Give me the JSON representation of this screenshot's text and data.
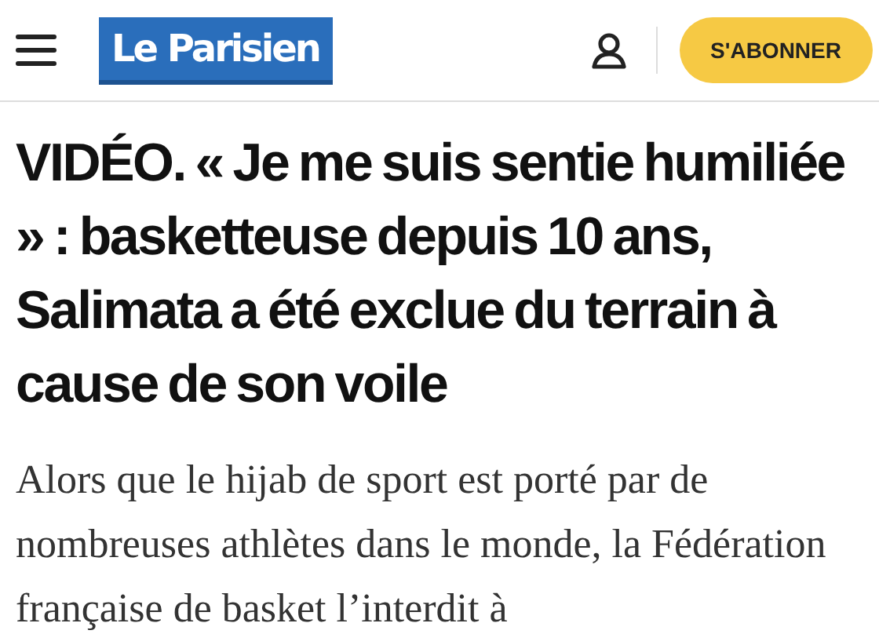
{
  "header": {
    "logo": "Le Parisien",
    "subscribe_button": "S'ABONNER"
  },
  "article": {
    "headline": "VIDÉO. « Je me suis sentie humiliée » : basketteuse depuis 10 ans, Salimata a été exclue du terrain à cause de son voile",
    "lead": "Alors que le hijab de sport est porté par de nombreuses athlètes dans le monde, la Fédération française de basket l’interdit à"
  }
}
